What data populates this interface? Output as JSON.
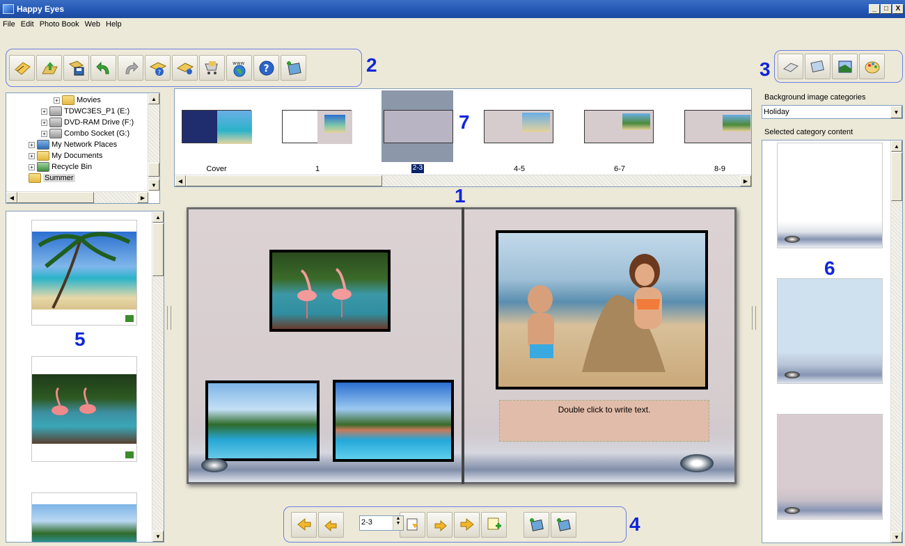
{
  "window": {
    "title": "Happy Eyes",
    "buttons": [
      "_",
      "□",
      "X"
    ]
  },
  "menu": [
    "File",
    "Edit",
    "Photo Book",
    "Web",
    "Help"
  ],
  "callouts": {
    "n1": "1",
    "n2": "2",
    "n3": "3",
    "n4": "4",
    "n5": "5",
    "n6": "6",
    "n7": "7"
  },
  "main_toolbar_icons": [
    "new-album-icon",
    "open-icon",
    "save-icon",
    "undo-icon",
    "redo-icon",
    "book-settings-icon",
    "album-properties-icon",
    "order-print-icon",
    "www-icon",
    "help-icon",
    "add-photos-icon"
  ],
  "bg_toolbar_icons": [
    "frame-icon",
    "photo-frame-icon",
    "crop-icon",
    "palette-icon"
  ],
  "tree": {
    "items": [
      {
        "label": "Movies",
        "type": "folder"
      },
      {
        "label": "TDWC3ES_P1 (E:)",
        "type": "drive"
      },
      {
        "label": "DVD-RAM Drive (F:)",
        "type": "drive"
      },
      {
        "label": "Combo Socket (G:)",
        "type": "drive"
      },
      {
        "label": "My Network Places",
        "type": "folder"
      },
      {
        "label": "My Documents",
        "type": "folder"
      },
      {
        "label": "Recycle Bin",
        "type": "folder"
      },
      {
        "label": "Summer",
        "type": "folder"
      }
    ]
  },
  "page_strip": {
    "labels": [
      "Cover",
      "1",
      "2-3",
      "4-5",
      "6-7",
      "8-9"
    ],
    "selected": "2-3"
  },
  "book": {
    "text_placeholder": "Double click to write text."
  },
  "nav": {
    "page_value": "2-3",
    "icons": [
      "first-page-icon",
      "prev-page-icon",
      "page-stepper",
      "edit-page-icon",
      "insert-page-icon",
      "next-page-icon",
      "new-page-icon",
      "add-photos-left-icon",
      "add-photos-right-icon"
    ]
  },
  "right_panel": {
    "categories_label": "Background image categories",
    "category_value": "Holiday",
    "content_label": "Selected category content"
  },
  "colors": {
    "accent": "#1026d8",
    "titlebar": "#2356b3",
    "page": "#d8cfd1"
  }
}
